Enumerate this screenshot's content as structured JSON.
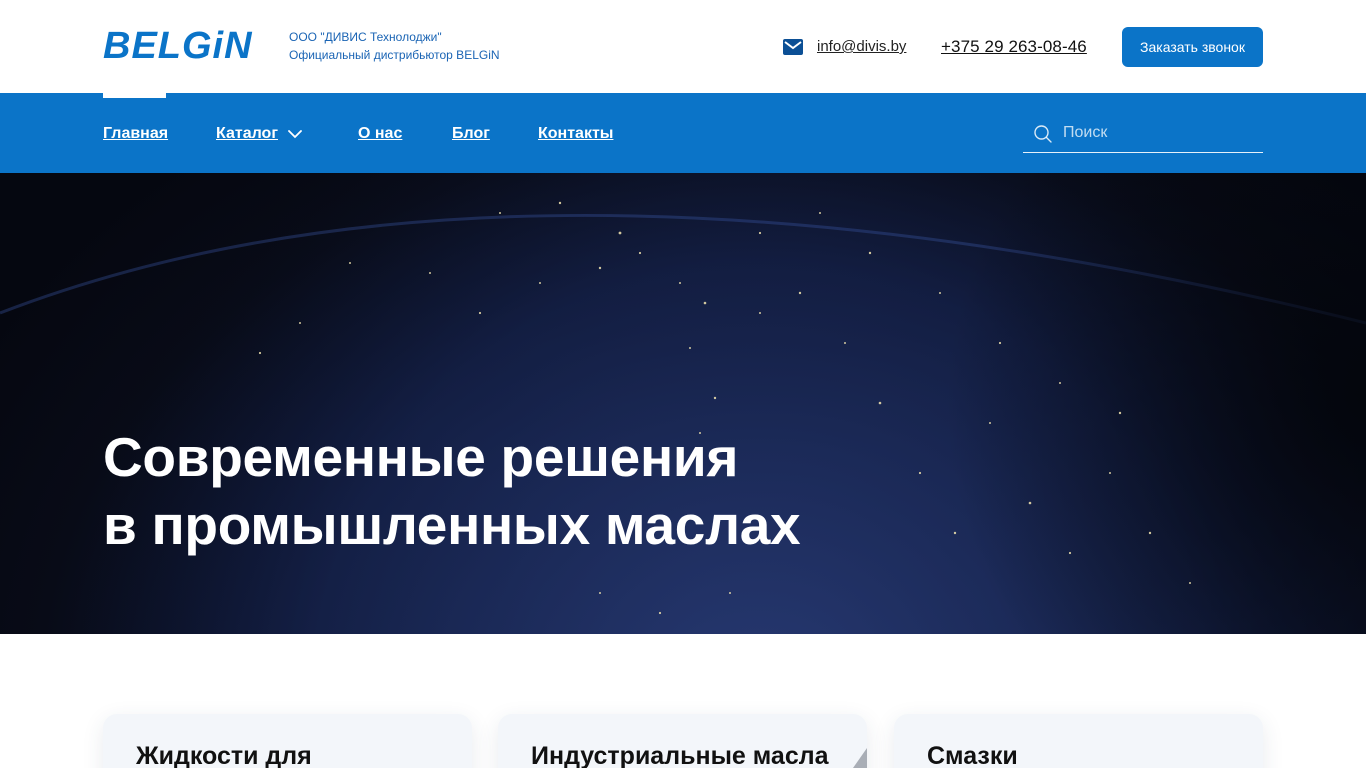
{
  "brand": {
    "logo_text": "BELGiN",
    "company_name": "ООО \"ДИВИС Технолоджи\"",
    "company_subtitle": "Официальный дистрибьютор BELGiN",
    "color": "#1a64b4"
  },
  "contact": {
    "email": "info@divis.by",
    "phone": "+375 29 263-08-46",
    "callback_label": "Заказать звонок"
  },
  "nav": {
    "items": [
      {
        "label": "Главная",
        "active": true
      },
      {
        "label": "Каталог",
        "has_dropdown": true
      },
      {
        "label": "О нас"
      },
      {
        "label": "Блог"
      },
      {
        "label": "Контакты"
      }
    ],
    "search_placeholder": "Поиск",
    "background": "#0b74c8"
  },
  "hero": {
    "title_line1": "Современные решения",
    "title_line2": "в промышленных маслах"
  },
  "cards": [
    {
      "title": "Жидкости для"
    },
    {
      "title": "Индустриальные масла"
    },
    {
      "title": "Смазки"
    }
  ],
  "colors": {
    "accent": "#0b74c8",
    "text_dark": "#111111",
    "card_bg": "#f3f6fa"
  }
}
